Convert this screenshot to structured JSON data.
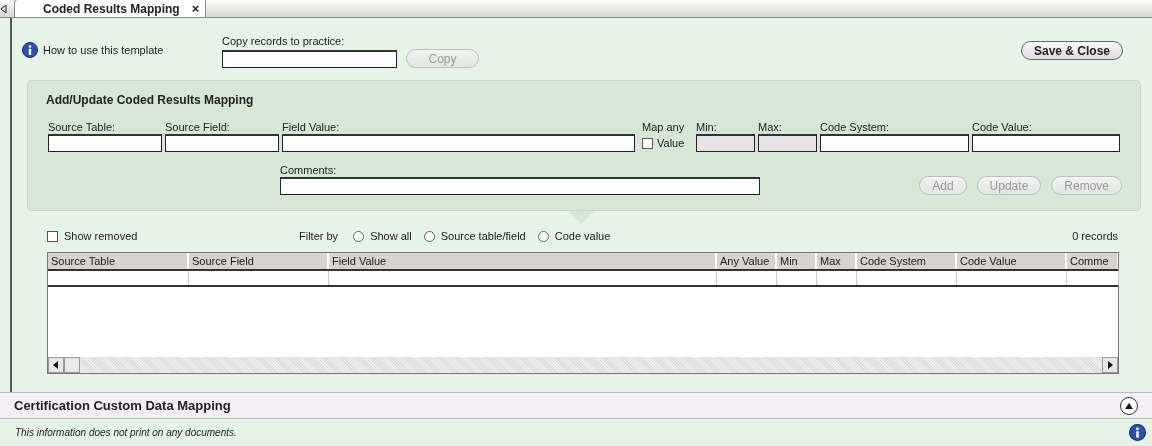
{
  "tab": {
    "label": "Coded Results Mapping",
    "close": "×",
    "selected": true
  },
  "help_link": "How to use this template",
  "copy": {
    "label": "Copy records to practice:",
    "button": "Copy",
    "disabled": true
  },
  "save_button": {
    "label": "Save & Close",
    "disabled": false
  },
  "form": {
    "title": "Add/Update Coded Results Mapping",
    "fields": [
      {
        "kind": "text",
        "label": "Source Table:",
        "disabled": false
      },
      {
        "kind": "text",
        "label": "Source Field:",
        "disabled": false
      },
      {
        "kind": "text",
        "label": "Field Value:",
        "disabled": false
      },
      {
        "kind": "checkbox",
        "label": "Map any",
        "option": "Value",
        "checked": false
      },
      {
        "kind": "text",
        "label": "Min:",
        "disabled": true
      },
      {
        "kind": "text",
        "label": "Max:",
        "disabled": true
      },
      {
        "kind": "text",
        "label": "Code System:",
        "disabled": false
      },
      {
        "kind": "text",
        "label": "Code Value:",
        "disabled": false
      }
    ],
    "comments": {
      "label": "Comments:"
    },
    "buttons": [
      {
        "label": "Add",
        "disabled": true
      },
      {
        "label": "Update",
        "disabled": true
      },
      {
        "label": "Remove",
        "disabled": true
      }
    ]
  },
  "show_removed": {
    "label": "Show removed",
    "checked": false
  },
  "filter": {
    "label": "Filter by",
    "options": [
      {
        "label": "Show all",
        "selected": false
      },
      {
        "label": "Source table/field",
        "selected": false
      },
      {
        "label": "Code value",
        "selected": false
      }
    ]
  },
  "record_count": "0 records",
  "table": {
    "columns": [
      "Source Table",
      "Source Field",
      "Field Value",
      "Any Value",
      "Min",
      "Max",
      "Code System",
      "Code Value",
      "Comme"
    ]
  },
  "section": {
    "title": "Certification Custom Data Mapping",
    "expanded": true,
    "note": "This information does not print on any documents."
  }
}
